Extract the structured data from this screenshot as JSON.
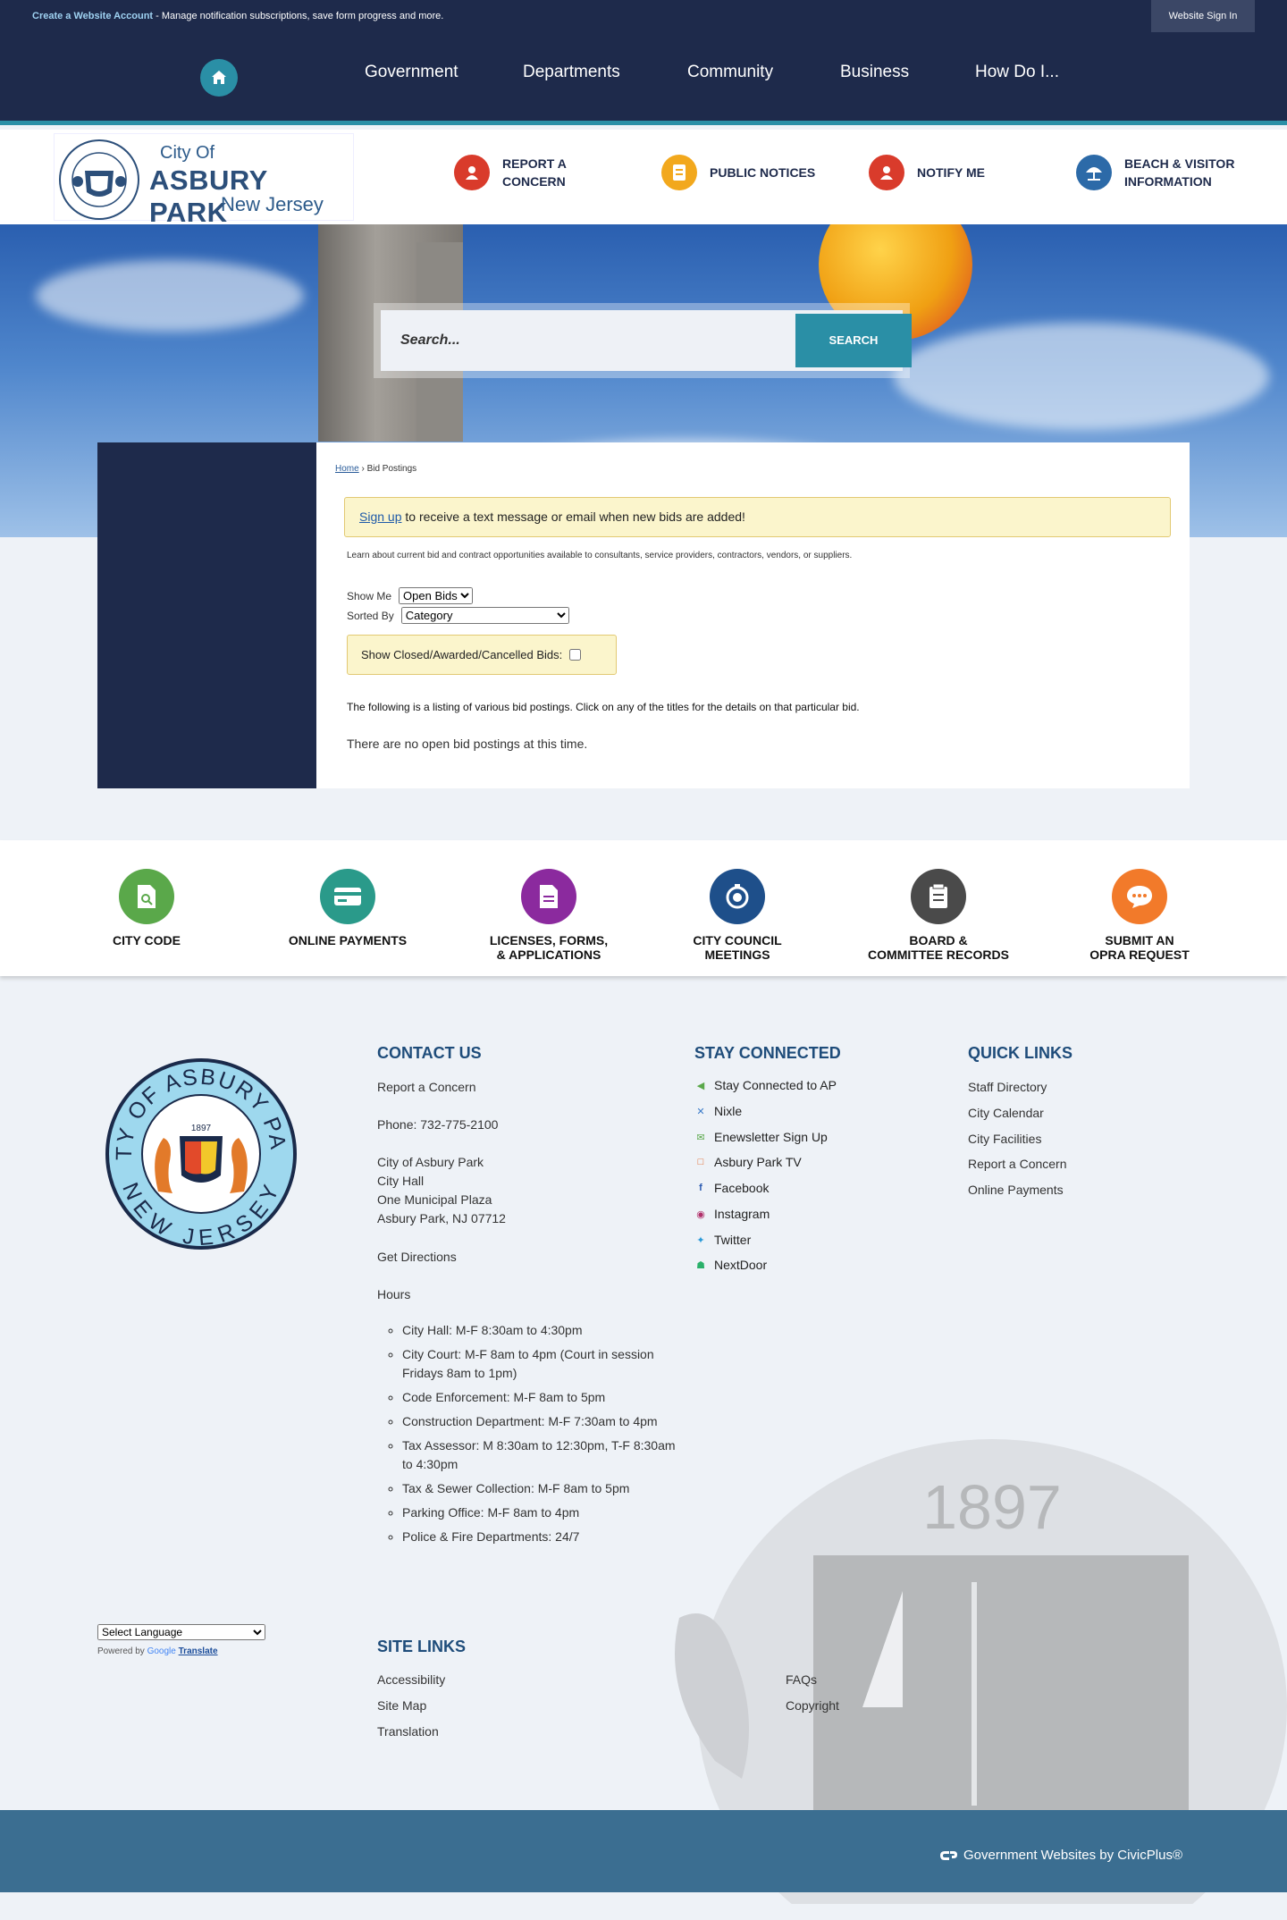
{
  "topbar": {
    "create_account": "Create a Website Account",
    "message": " - Manage notification subscriptions, save form progress and more.",
    "sign_in": "Website Sign In"
  },
  "nav": {
    "items": [
      "Government",
      "Departments",
      "Community",
      "Business",
      "How Do I..."
    ]
  },
  "logo": {
    "line1": "City Of",
    "line2": "ASBURY PARK",
    "line3": "New Jersey"
  },
  "quick": [
    {
      "label": "REPORT A\nCONCERN",
      "icon": "alert-icon",
      "color": "#d93b2b"
    },
    {
      "label": "PUBLIC NOTICES",
      "icon": "notice-icon",
      "color": "#f2a81d"
    },
    {
      "label": "NOTIFY ME",
      "icon": "notify-icon",
      "color": "#d93b2b"
    },
    {
      "label": "BEACH & VISITOR\nINFORMATION",
      "icon": "umbrella-icon",
      "color": "#2c6aa8"
    }
  ],
  "search": {
    "placeholder": "Search...",
    "button": "SEARCH"
  },
  "breadcrumb": {
    "home": "Home",
    "separator": " › ",
    "current": "Bid Postings"
  },
  "notice": {
    "link": "Sign up",
    "text": " to receive a text message or email when new bids are added!"
  },
  "intro": "Learn about current bid and contract opportunities available to consultants, service providers, contractors, vendors, or suppliers.",
  "filters": {
    "show_me_label": "Show Me",
    "show_me_value": "Open Bids",
    "sorted_by_label": "Sorted By",
    "sorted_by_value": "Category",
    "closed_label": "Show Closed/Awarded/Cancelled Bids:"
  },
  "listing_text": "The following is a listing of various bid postings. Click on any of the titles for the details on that particular bid.",
  "no_bids": "There are no open bid postings at this time.",
  "strip": [
    {
      "label": "CITY CODE",
      "icon": "code-doc-icon",
      "color": "#5aa84a"
    },
    {
      "label": "ONLINE PAYMENTS",
      "icon": "payment-card-icon",
      "color": "#2a9a8a"
    },
    {
      "label": "LICENSES, FORMS,\n& APPLICATIONS",
      "icon": "form-doc-icon",
      "color": "#8b2a9e"
    },
    {
      "label": "CITY COUNCIL\nMEETINGS",
      "icon": "meeting-icon",
      "color": "#1e4f8a"
    },
    {
      "label": "BOARD &\nCOMMITTEE RECORDS",
      "icon": "records-icon",
      "color": "#4a4a4a"
    },
    {
      "label": "SUBMIT AN\nOPRA REQUEST",
      "icon": "chat-bubble-icon",
      "color": "#f27a2a"
    }
  ],
  "contact": {
    "heading": "CONTACT US",
    "report": "Report a Concern",
    "phone": "Phone: 732-775-2100",
    "address": [
      "City of Asbury Park",
      "City Hall",
      "One Municipal Plaza",
      "Asbury Park, NJ 07712"
    ],
    "directions": "Get Directions",
    "hours_label": "Hours",
    "hours": [
      "City Hall: M-F 8:30am to 4:30pm",
      "City Court: M-F 8am to 4pm (Court in session Fridays 8am to 1pm)",
      "Code Enforcement: M-F 8am to 5pm",
      "Construction Department: M-F 7:30am to 4pm",
      "Tax Assessor: M 8:30am to 12:30pm, T-F 8:30am to 4:30pm",
      "Tax & Sewer Collection: M-F 8am to 5pm",
      "Parking Office: M-F 8am to 4pm",
      "Police & Fire Departments: 24/7"
    ]
  },
  "stay": {
    "heading": "STAY CONNECTED",
    "items": [
      {
        "label": "Stay Connected to AP",
        "icon": "share-icon",
        "color": "#5aa84a"
      },
      {
        "label": "Nixle",
        "icon": "nixle-icon",
        "color": "#3a7ac8"
      },
      {
        "label": "Enewsletter Sign Up",
        "icon": "envelope-icon",
        "color": "#5aa84a"
      },
      {
        "label": "Asbury Park TV",
        "icon": "tv-icon",
        "color": "#e2662a"
      },
      {
        "label": "Facebook",
        "icon": "facebook-icon",
        "color": "#2a5ab0"
      },
      {
        "label": "Instagram",
        "icon": "instagram-icon",
        "color": "#b0306a"
      },
      {
        "label": "Twitter",
        "icon": "twitter-icon",
        "color": "#2a9ad8"
      },
      {
        "label": "NextDoor",
        "icon": "nextdoor-icon",
        "color": "#2ab06a"
      }
    ]
  },
  "quicklinks": {
    "heading": "QUICK LINKS",
    "items": [
      "Staff Directory",
      "City Calendar",
      "City Facilities",
      "Report a Concern",
      "Online Payments"
    ]
  },
  "sitelinks": {
    "heading": "SITE LINKS",
    "col1": [
      "Accessibility",
      "Site Map",
      "Translation"
    ],
    "col2": [
      "FAQs",
      "Copyright"
    ]
  },
  "translate": {
    "select": "Select Language",
    "powered": "Powered by ",
    "google": "Google",
    "translate": "Translate"
  },
  "seal": {
    "top": "CITY OF ASBURY PARK",
    "bottom": "NEW JERSEY",
    "year": "1897"
  },
  "civicplus": "Government Websites by CivicPlus®"
}
